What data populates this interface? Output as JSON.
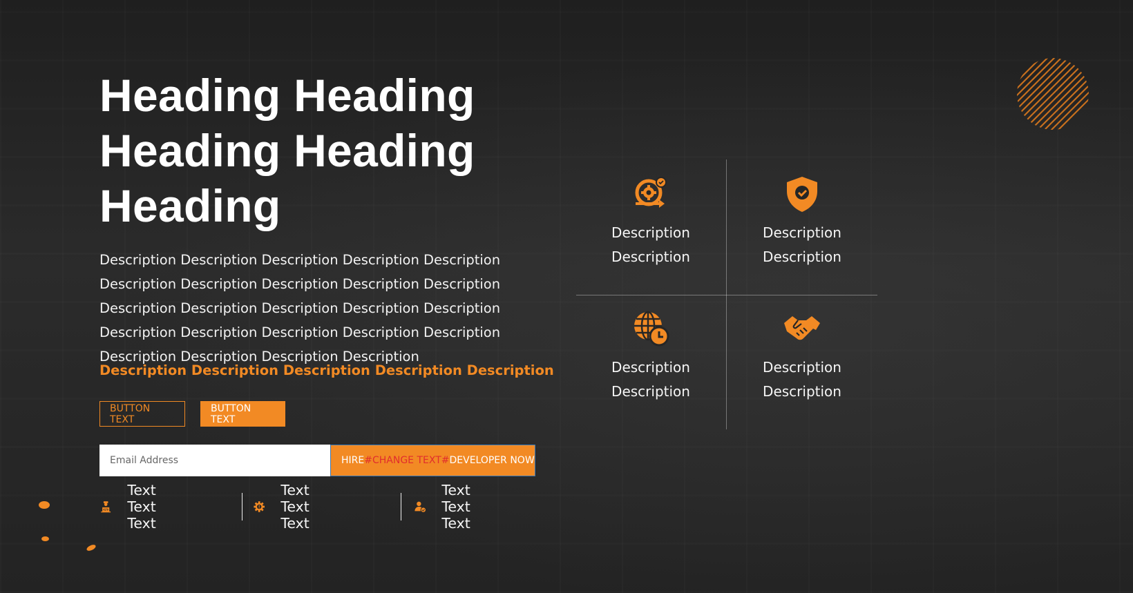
{
  "hero": {
    "heading": "Heading Heading Heading Heading Heading",
    "description": "Description Description Description Description Description Description Description Description Description Description Description Description Description Description Description Description Description Description Description Description Description Description Description Description",
    "accent_description": "Description Description Description Description Description",
    "button_outline_label": "BUTTON TEXT",
    "button_filled_label": "BUTTON TEXT"
  },
  "signup": {
    "email_placeholder": "Email Address",
    "hire_prefix": "HIRE",
    "hire_hash_open": "# ",
    "hire_change": "CHANGE TEXT ",
    "hire_hash_close": "#",
    "hire_suffix": "DEVELOPER NOW"
  },
  "features": [
    {
      "icon": "developer-icon",
      "label": "Text Text Text"
    },
    {
      "icon": "gear-alert-icon",
      "label": "Text Text Text"
    },
    {
      "icon": "user-check-icon",
      "label": "Text Text Text"
    }
  ],
  "grid": [
    {
      "icon": "gear-progress-icon",
      "line1": "Description",
      "line2": "Description"
    },
    {
      "icon": "shield-check-icon",
      "line1": "Description",
      "line2": "Description"
    },
    {
      "icon": "globe-clock-icon",
      "line1": "Description",
      "line2": "Description"
    },
    {
      "icon": "handshake-icon",
      "line1": "Description",
      "line2": "Description"
    }
  ],
  "colors": {
    "accent": "#f28a24",
    "background": "#262626",
    "highlight_red": "#e12d2d"
  }
}
